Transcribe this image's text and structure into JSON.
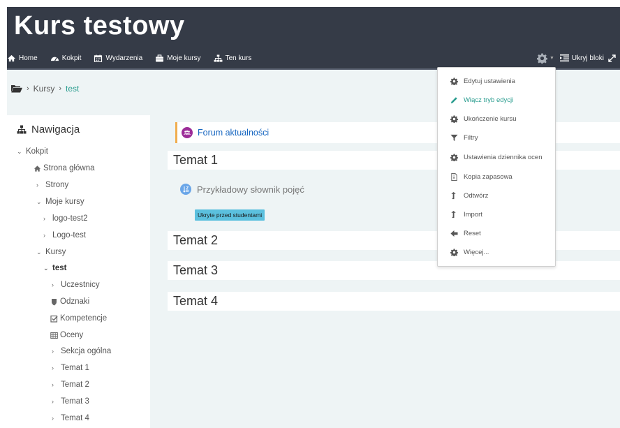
{
  "header": {
    "site_title": "Kurs testowy",
    "nav": [
      {
        "label": "Home",
        "icon": "home-icon"
      },
      {
        "label": "Kokpit",
        "icon": "dashboard-icon"
      },
      {
        "label": "Wydarzenia",
        "icon": "calendar-icon"
      },
      {
        "label": "Moje kursy",
        "icon": "briefcase-icon"
      },
      {
        "label": "Ten kurs",
        "icon": "sitemap-icon"
      }
    ],
    "hide_blocks": "Ukryj bloki"
  },
  "breadcrumb": {
    "items": [
      "Kursy",
      "test"
    ]
  },
  "navigation": {
    "title": "Nawigacja",
    "items": [
      {
        "label": "Kokpit"
      },
      {
        "label": "Strona główna"
      },
      {
        "label": "Strony"
      },
      {
        "label": "Moje kursy"
      },
      {
        "label": "logo-test2"
      },
      {
        "label": "Logo-test"
      },
      {
        "label": "Kursy"
      },
      {
        "label": "test"
      },
      {
        "label": "Uczestnicy"
      },
      {
        "label": "Odznaki"
      },
      {
        "label": "Kompetencje"
      },
      {
        "label": "Oceny"
      },
      {
        "label": "Sekcja ogólna"
      },
      {
        "label": "Temat 1"
      },
      {
        "label": "Temat 2"
      },
      {
        "label": "Temat 3"
      },
      {
        "label": "Temat 4"
      }
    ]
  },
  "main": {
    "forum": "Forum aktualności",
    "topics": [
      "Temat 1",
      "Temat 2",
      "Temat 3",
      "Temat 4"
    ],
    "glossary": "Przykładowy słownik pojęć",
    "hidden_badge": "Ukryte przed studentami"
  },
  "menu": {
    "items": [
      {
        "label": "Edytuj ustawienia",
        "icon": "gear-icon"
      },
      {
        "label": "Włącz tryb edycji",
        "icon": "pencil-icon"
      },
      {
        "label": "Ukończenie kursu",
        "icon": "gear-icon"
      },
      {
        "label": "Filtry",
        "icon": "filter-icon"
      },
      {
        "label": "Ustawienia dziennika ocen",
        "icon": "gear-icon"
      },
      {
        "label": "Kopia zapasowa",
        "icon": "file-archive-icon"
      },
      {
        "label": "Odtwórz",
        "icon": "level-up-icon"
      },
      {
        "label": "Import",
        "icon": "level-up-icon"
      },
      {
        "label": "Reset",
        "icon": "arrow-left-icon"
      },
      {
        "label": "Więcej...",
        "icon": "gear-icon"
      }
    ]
  },
  "colors": {
    "header_bg": "#353b47",
    "page_bg": "#eef4f5",
    "accent_link": "#2a9d8f",
    "forum_link": "#1565c0",
    "badge_bg": "#5bc0de",
    "forum_border": "#f0ad4e"
  }
}
